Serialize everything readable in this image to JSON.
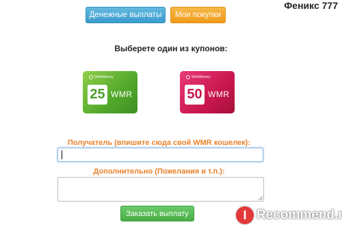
{
  "header": {
    "username": "Феникс 777",
    "tabs": [
      {
        "label": "Денежные выплаты",
        "color": "#49a8d6"
      },
      {
        "label": "Мои покупки",
        "color": "#f2a52c"
      }
    ]
  },
  "main": {
    "choose_title": "Выберете один из купонов:",
    "coupons": [
      {
        "brand": "WebMoney",
        "amount": "25",
        "currency": "WMR",
        "color": "#5aad2e"
      },
      {
        "brand": "WebMoney",
        "amount": "50",
        "currency": "WMR",
        "color": "#cc1a52"
      }
    ],
    "recipient_label": "Получатель (впишите сюда свой WMR кошелек):",
    "recipient_value": "",
    "extra_label": "Дополнительно (Пожелания и т.п.):",
    "extra_value": "",
    "submit_label": "Заказать выплату"
  },
  "watermark": {
    "icon_letter": "I",
    "text": "Recommend.ru"
  }
}
